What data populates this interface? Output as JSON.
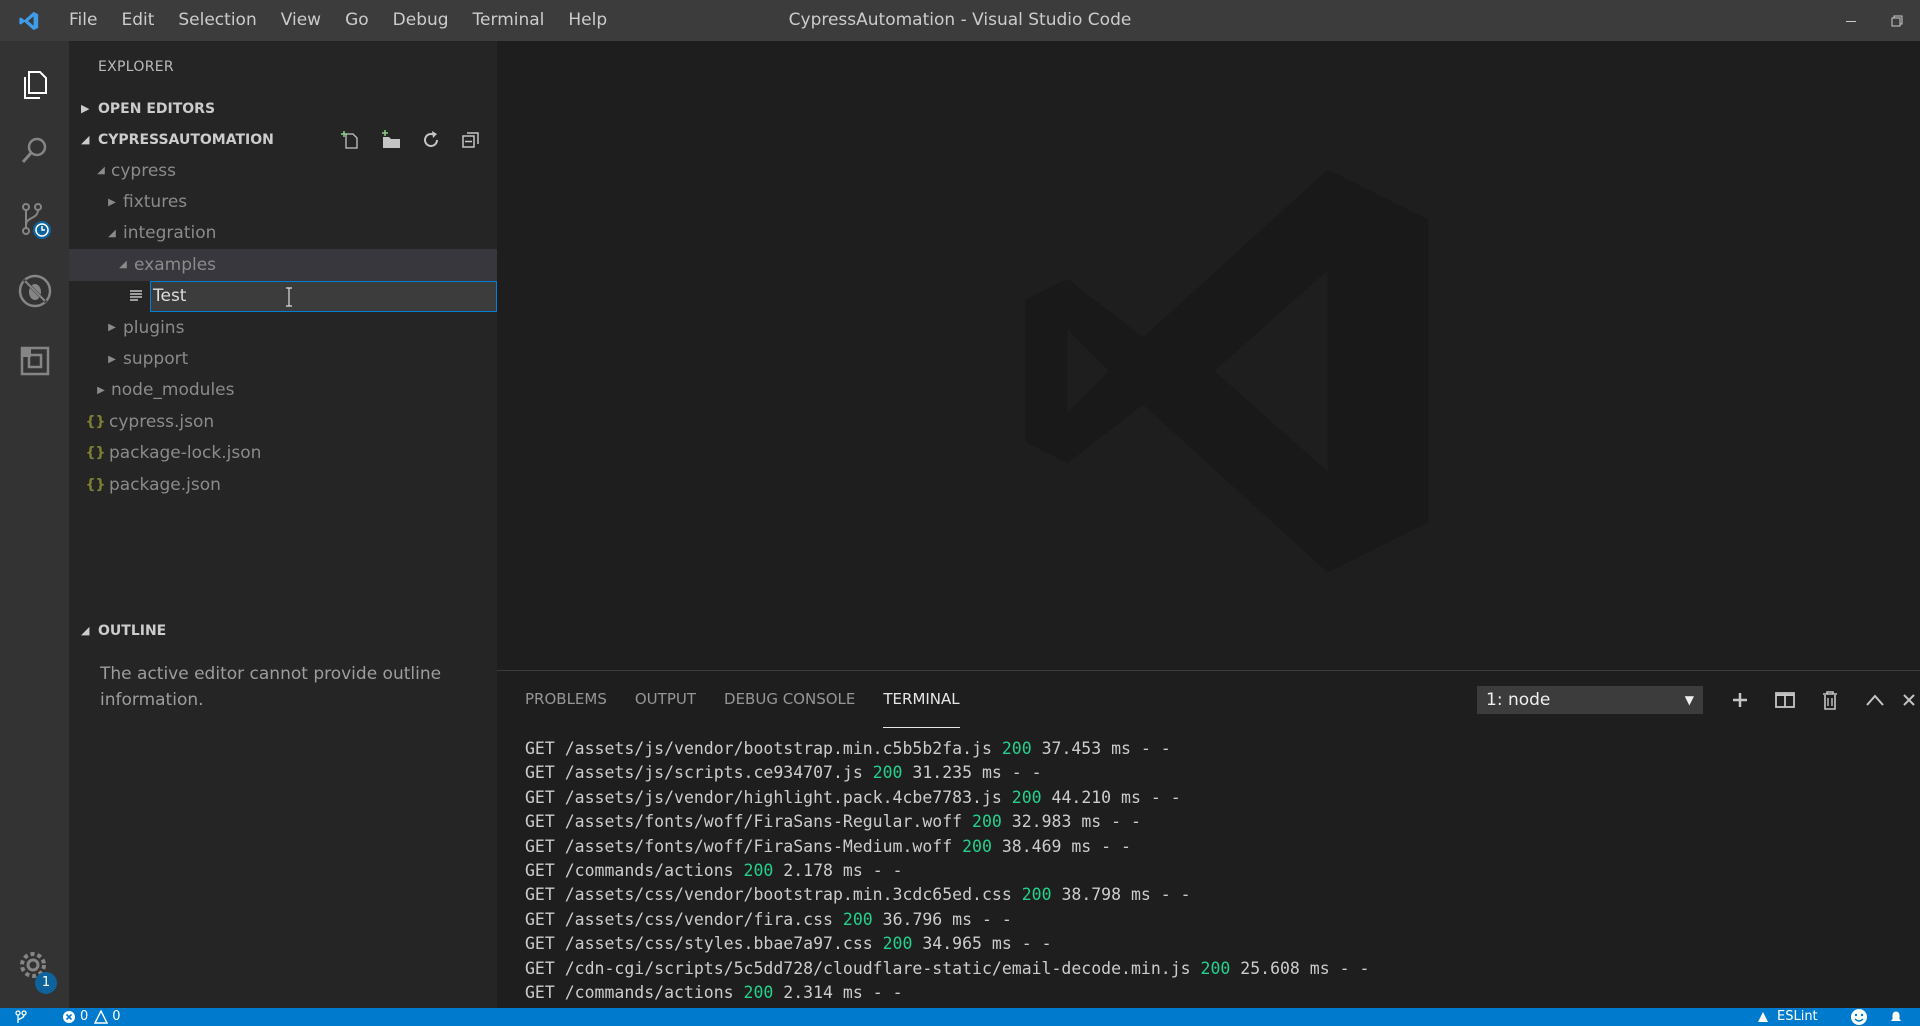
{
  "window": {
    "title": "CypressAutomation - Visual Studio Code",
    "menu": [
      "File",
      "Edit",
      "Selection",
      "View",
      "Go",
      "Debug",
      "Terminal",
      "Help"
    ]
  },
  "activity_bar": {
    "source_control_badge": "",
    "settings_badge": "1"
  },
  "sidebar": {
    "title": "EXPLORER",
    "open_editors_label": "OPEN EDITORS",
    "project_label": "CYPRESSAUTOMATION",
    "tree": [
      {
        "label": "cypress",
        "depth": 0,
        "expanded": true
      },
      {
        "label": "fixtures",
        "depth": 1,
        "expanded": false
      },
      {
        "label": "integration",
        "depth": 1,
        "expanded": true
      },
      {
        "label": "examples",
        "depth": 2,
        "expanded": true
      }
    ],
    "rename_value": "Test",
    "tree_after": [
      {
        "label": "plugins",
        "depth": 1
      },
      {
        "label": "support",
        "depth": 1
      },
      {
        "label": "node_modules",
        "depth": 0
      }
    ],
    "files": [
      "cypress.json",
      "package-lock.json",
      "package.json"
    ],
    "outline_label": "OUTLINE",
    "outline_message": "The active editor cannot provide outline information."
  },
  "panel": {
    "tabs": [
      "PROBLEMS",
      "OUTPUT",
      "DEBUG CONSOLE",
      "TERMINAL"
    ],
    "active_tab": "TERMINAL",
    "terminal_select": "1: node",
    "lines": [
      {
        "pre": "GET /assets/js/vendor/bootstrap.min.c5b5b2fa.js ",
        "status": "200",
        "post": " 37.453 ms - -"
      },
      {
        "pre": "GET /assets/js/scripts.ce934707.js ",
        "status": "200",
        "post": " 31.235 ms - -"
      },
      {
        "pre": "GET /assets/js/vendor/highlight.pack.4cbe7783.js ",
        "status": "200",
        "post": " 44.210 ms - -"
      },
      {
        "pre": "GET /assets/fonts/woff/FiraSans-Regular.woff ",
        "status": "200",
        "post": " 32.983 ms - -"
      },
      {
        "pre": "GET /assets/fonts/woff/FiraSans-Medium.woff ",
        "status": "200",
        "post": " 38.469 ms - -"
      },
      {
        "pre": "GET /commands/actions ",
        "status": "200",
        "post": " 2.178 ms - -"
      },
      {
        "pre": "GET /assets/css/vendor/bootstrap.min.3cdc65ed.css ",
        "status": "200",
        "post": " 38.798 ms - -"
      },
      {
        "pre": "GET /assets/css/vendor/fira.css ",
        "status": "200",
        "post": " 36.796 ms - -"
      },
      {
        "pre": "GET /assets/css/styles.bbae7a97.css ",
        "status": "200",
        "post": " 34.965 ms - -"
      },
      {
        "pre": "GET /cdn-cgi/scripts/5c5dd728/cloudflare-static/email-decode.min.js ",
        "status": "200",
        "post": " 25.608 ms - -"
      },
      {
        "pre": "GET /commands/actions ",
        "status": "200",
        "post": " 2.314 ms - -"
      }
    ]
  },
  "statusbar": {
    "errors": "0",
    "warnings": "0",
    "eslint": "ESLint"
  },
  "colors": {
    "accent": "#007acc",
    "status_ok": "#23d18b",
    "json_icon": "#cbcb41"
  }
}
